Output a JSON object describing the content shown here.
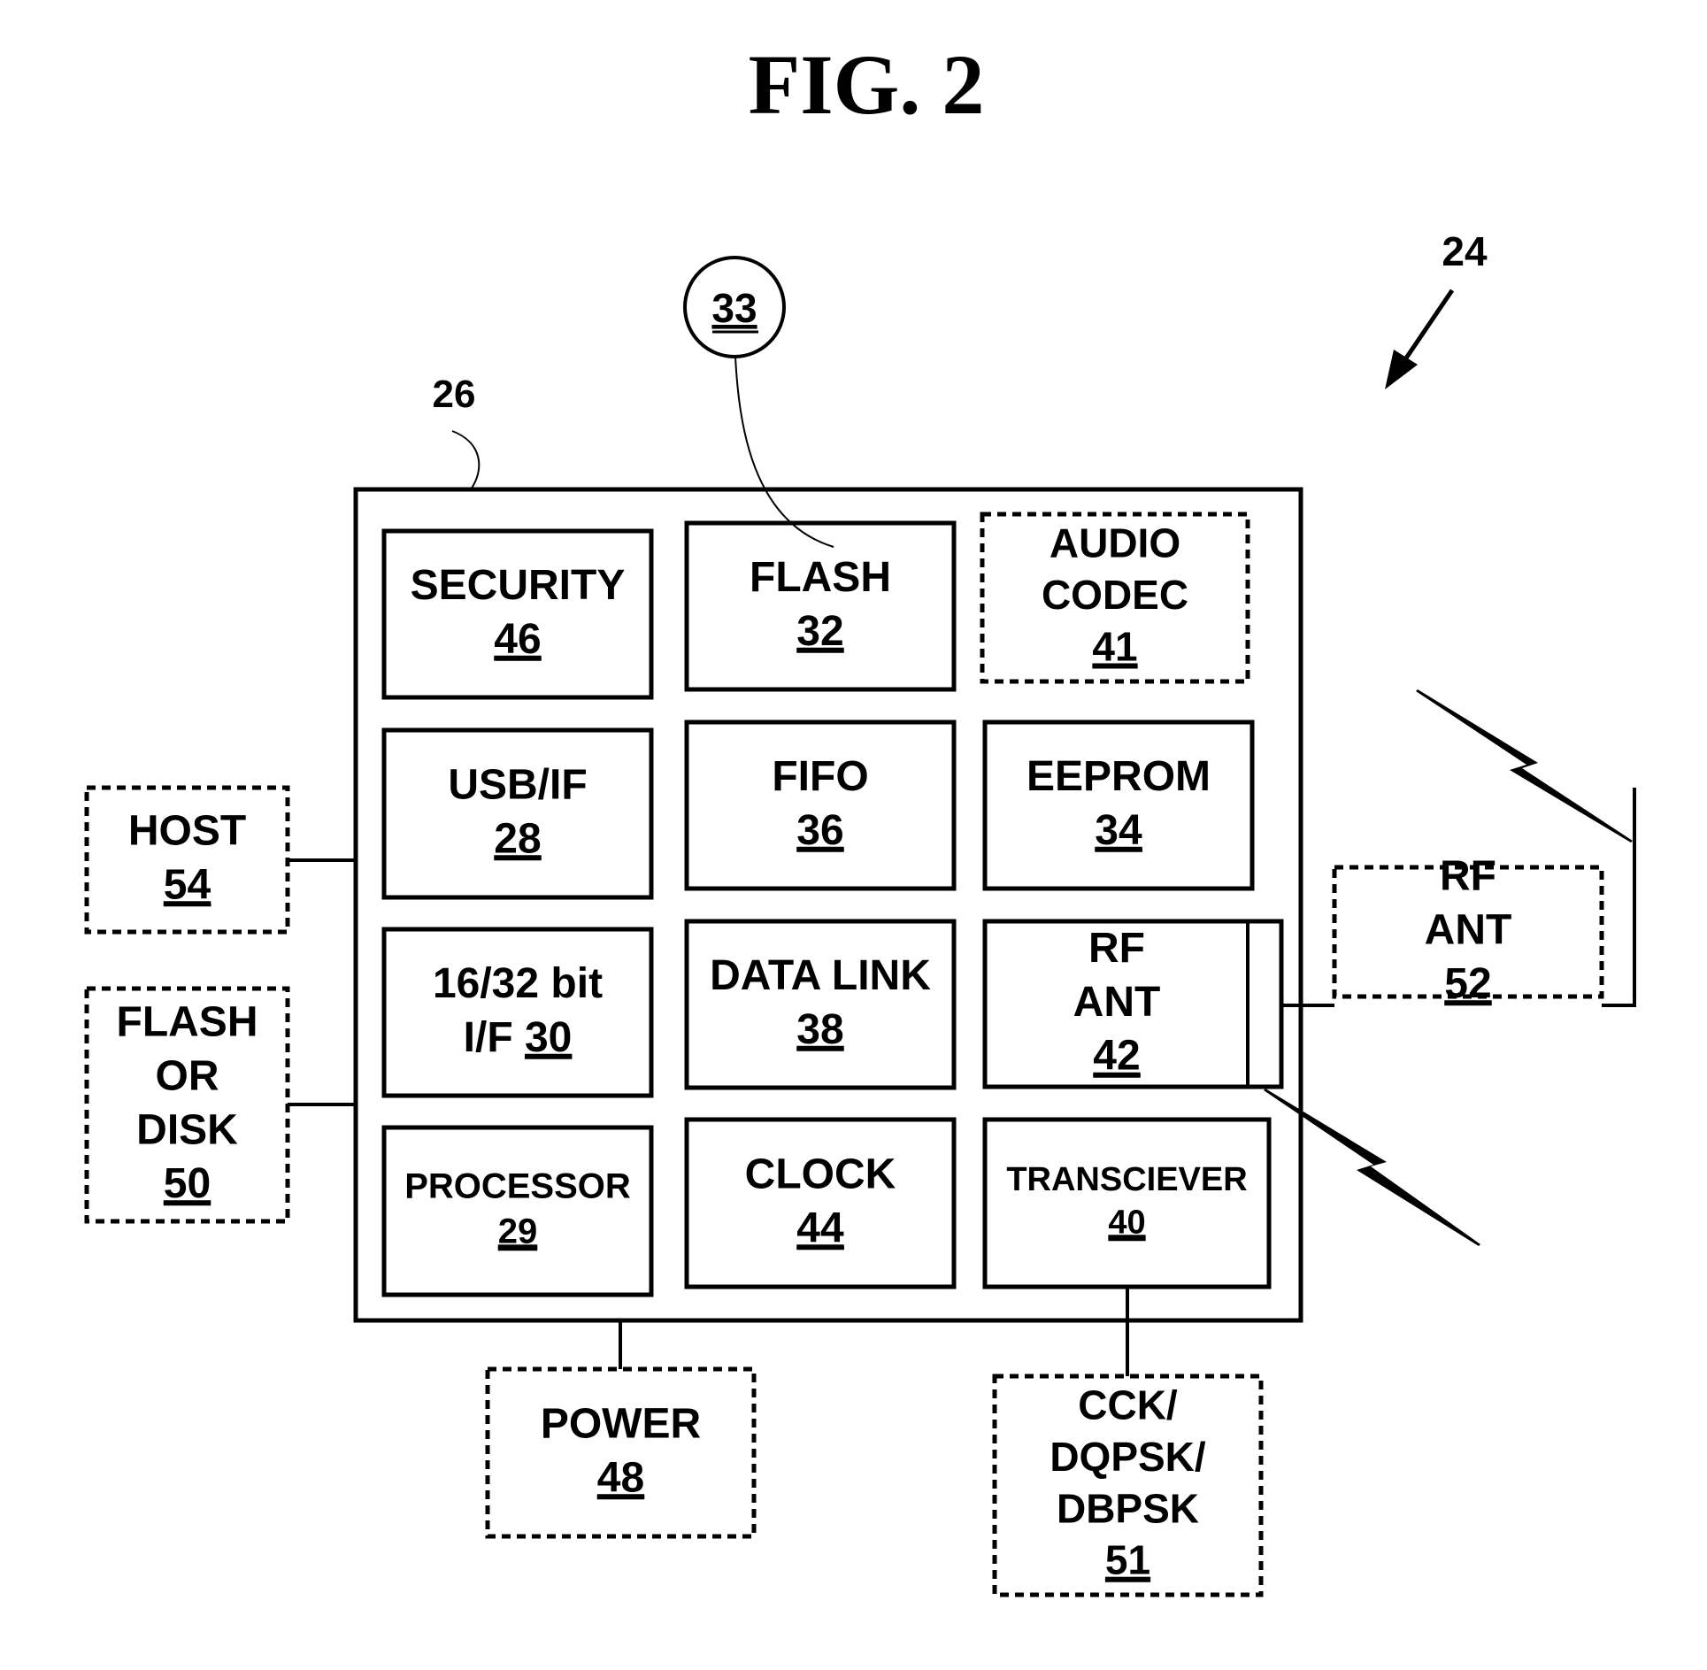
{
  "figure": {
    "title": "FIG. 2",
    "device_ref": "24",
    "module_ref": "26",
    "callout_ref": "33",
    "colors": {
      "ink": "#000000",
      "paper": "#ffffff"
    }
  },
  "internal_blocks": [
    {
      "id": "security",
      "lines": [
        "SECURITY"
      ],
      "ref": "46",
      "border": "solid"
    },
    {
      "id": "flash",
      "lines": [
        "FLASH"
      ],
      "ref": "32",
      "border": "solid"
    },
    {
      "id": "audio-codec",
      "lines": [
        "AUDIO",
        "CODEC"
      ],
      "ref": "41",
      "border": "dashed"
    },
    {
      "id": "usb-if",
      "lines": [
        "USB/IF"
      ],
      "ref": "28",
      "border": "solid"
    },
    {
      "id": "fifo",
      "lines": [
        "FIFO"
      ],
      "ref": "36",
      "border": "solid"
    },
    {
      "id": "eeprom",
      "lines": [
        "EEPROM"
      ],
      "ref": "34",
      "border": "solid"
    },
    {
      "id": "bus-interface",
      "lines": [
        "16/32 bit"
      ],
      "inline_prefix": "I/F ",
      "ref": "30",
      "border": "solid"
    },
    {
      "id": "data-link",
      "lines": [
        "DATA LINK"
      ],
      "ref": "38",
      "border": "solid"
    },
    {
      "id": "rf-ant-internal",
      "lines": [
        "RF",
        "ANT"
      ],
      "ref": "42",
      "border": "solid"
    },
    {
      "id": "processor",
      "lines": [
        "PROCESSOR"
      ],
      "ref": "29",
      "border": "solid"
    },
    {
      "id": "clock",
      "lines": [
        "CLOCK"
      ],
      "ref": "44",
      "border": "solid"
    },
    {
      "id": "transceiver",
      "lines": [
        "TRANSCIEVER"
      ],
      "ref": "40",
      "border": "solid"
    }
  ],
  "external_blocks": [
    {
      "id": "host",
      "lines": [
        "HOST"
      ],
      "ref": "54",
      "border": "dashed"
    },
    {
      "id": "flash-or-disk",
      "lines": [
        "FLASH",
        "OR",
        "DISK"
      ],
      "ref": "50",
      "border": "dashed"
    },
    {
      "id": "power",
      "lines": [
        "POWER"
      ],
      "ref": "48",
      "border": "dashed"
    },
    {
      "id": "modulation",
      "lines": [
        "CCK/",
        "DQPSK/",
        "DBPSK"
      ],
      "ref": "51",
      "border": "dashed"
    },
    {
      "id": "rf-ant-external",
      "lines": [
        "RF",
        "ANT"
      ],
      "ref": "52",
      "border": "dashed"
    }
  ]
}
